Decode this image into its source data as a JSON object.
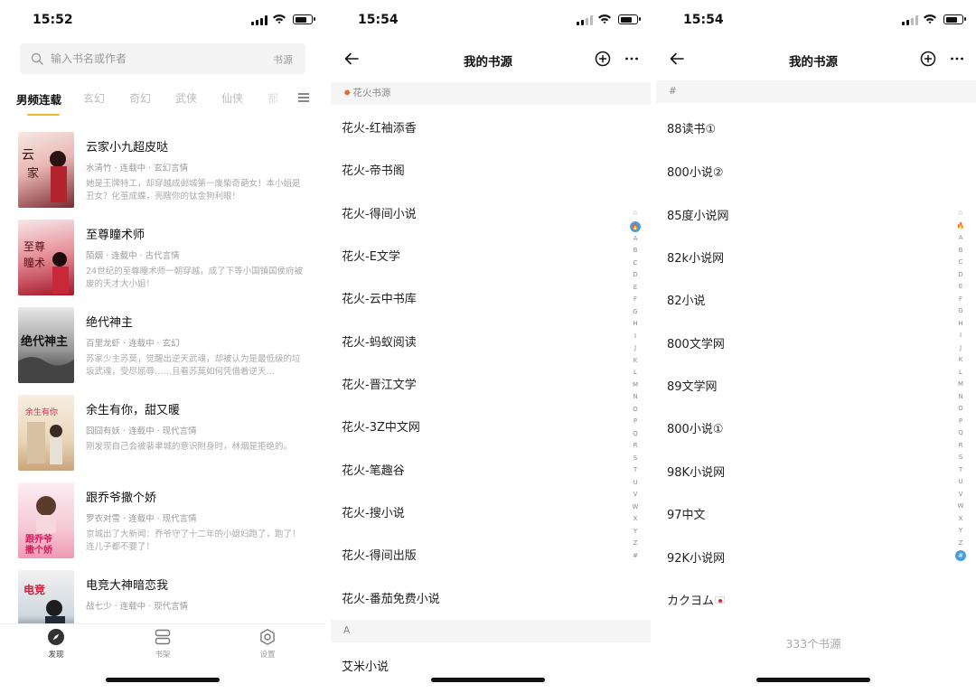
{
  "colors": {
    "accent": "#f2b62c",
    "index_selected": "#4a9ee0",
    "section_bg": "#f5f5f5"
  },
  "screen1": {
    "time": "15:52",
    "search": {
      "placeholder": "输入书名或作者",
      "source_label": "书源"
    },
    "categories": [
      "男频连载",
      "玄幻",
      "奇幻",
      "武侠",
      "仙侠",
      "都"
    ],
    "books": [
      {
        "title": "云家小九超皮哒",
        "author": "水清竹",
        "status": "连载中",
        "genre": "玄幻言情",
        "desc": "她是王牌特工，却穿越成邺城第一废柴奇葩女！本小姐是丑女？化茧成蝶，亮瞎你的钛金狗利眼！"
      },
      {
        "title": "至尊瞳术师",
        "author": "陌烟",
        "status": "连载中",
        "genre": "古代言情",
        "desc": "24世纪的至尊瞳术师一朝穿越，成了下等小国镇国侯府被废的天才大小姐！"
      },
      {
        "title": "绝代神主",
        "author": "百里龙虾",
        "status": "连载中",
        "genre": "玄幻",
        "desc": "苏家少主苏莫，觉醒出逆天武魂，却被认为是最低级的垃圾武魂，受尽屈辱……且看苏莫如何凭借着逆天…"
      },
      {
        "title": "余生有你，甜又暖",
        "author": "囧囧有妖",
        "status": "连载中",
        "genre": "现代言情",
        "desc": "刚发现自己会被裴聿城的意识附身时，林烟是拒绝的。"
      },
      {
        "title": "跟乔爷撒个娇",
        "author": "罗衣对雪",
        "status": "连载中",
        "genre": "现代言情",
        "desc": "京城出了大新闻：乔爷守了十二年的小媳妇跑了，跑了！连儿子都不要了！"
      },
      {
        "title": "电竞大神暗恋我",
        "author": "战七少",
        "status": "连载中",
        "genre": "现代言情",
        "desc": ""
      }
    ],
    "tabs": [
      {
        "label": "发现",
        "icon": "compass-icon"
      },
      {
        "label": "书架",
        "icon": "bookshelf-icon"
      },
      {
        "label": "设置",
        "icon": "settings-icon"
      }
    ]
  },
  "screen2": {
    "time": "15:54",
    "title": "我的书源",
    "section_top": "花火书源",
    "rows": [
      "花火-红袖添香",
      "花火-帝书阁",
      "花火-得间小说",
      "花火-E文学",
      "花火-云中书库",
      "花火-蚂蚁阅读",
      "花火-晋江文学",
      "花火-3Z中文网",
      "花火-笔趣谷",
      "花火-搜小说",
      "花火-得间出版",
      "花火-番茄免费小说"
    ],
    "section_bottom": "A",
    "row_after": "艾米小说",
    "index": [
      "☆",
      "🔥",
      "A",
      "B",
      "C",
      "D",
      "E",
      "F",
      "G",
      "H",
      "I",
      "J",
      "K",
      "L",
      "M",
      "N",
      "O",
      "P",
      "Q",
      "R",
      "S",
      "T",
      "U",
      "V",
      "W",
      "X",
      "Y",
      "Z",
      "#"
    ]
  },
  "screen3": {
    "time": "15:54",
    "title": "我的书源",
    "section_top": "#",
    "rows": [
      "88读书①",
      "800小说②",
      "85度小说网",
      "82k小说网",
      "82小说",
      "800文学网",
      "89文学网",
      "800小说①",
      "98K小说网",
      "97中文",
      "92K小说网",
      "カクヨム"
    ],
    "count": "333个书源",
    "index": [
      "☆",
      "🔥",
      "A",
      "B",
      "C",
      "D",
      "E",
      "F",
      "G",
      "H",
      "I",
      "J",
      "K",
      "L",
      "M",
      "N",
      "O",
      "P",
      "Q",
      "R",
      "S",
      "T",
      "U",
      "V",
      "W",
      "X",
      "Y",
      "Z",
      "#"
    ]
  }
}
